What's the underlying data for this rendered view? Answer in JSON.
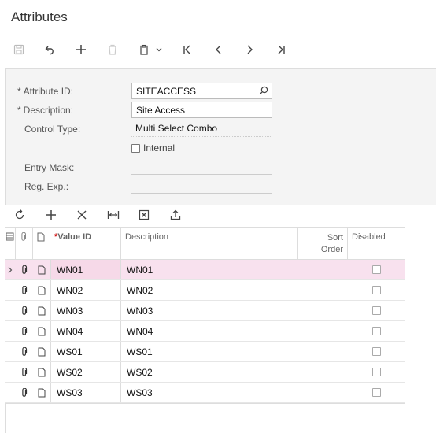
{
  "page": {
    "title": "Attributes"
  },
  "toolbar": {
    "buttons": [
      "save-icon",
      "undo-icon",
      "add-icon",
      "delete-icon",
      "clipboard-icon",
      "first-icon",
      "prev-icon",
      "next-icon",
      "last-icon"
    ]
  },
  "form": {
    "attribute_id_label": "Attribute ID:",
    "attribute_id_value": "SITEACCESS",
    "description_label": "Description:",
    "description_value": "Site Access",
    "control_type_label": "Control Type:",
    "control_type_value": "Multi Select Combo",
    "internal_label": "Internal",
    "internal_checked": false,
    "entry_mask_label": "Entry Mask:",
    "entry_mask_value": "",
    "reg_exp_label": "Reg. Exp.:",
    "reg_exp_value": "",
    "required_marker": "*"
  },
  "grid_toolbar": {
    "buttons": [
      "refresh-icon",
      "add-row-icon",
      "delete-row-icon",
      "fit-columns-icon",
      "export-excel-icon",
      "upload-icon"
    ]
  },
  "grid": {
    "columns": {
      "value_id": "Value ID",
      "description": "Description",
      "sort_order_1": "Sort",
      "sort_order_2": "Order",
      "disabled": "Disabled",
      "required_marker": "*"
    },
    "rows": [
      {
        "value_id": "WN01",
        "description": "WN01",
        "disabled": false
      },
      {
        "value_id": "WN02",
        "description": "WN02",
        "disabled": false
      },
      {
        "value_id": "WN03",
        "description": "WN03",
        "disabled": false
      },
      {
        "value_id": "WN04",
        "description": "WN04",
        "disabled": false
      },
      {
        "value_id": "WS01",
        "description": "WS01",
        "disabled": false
      },
      {
        "value_id": "WS02",
        "description": "WS02",
        "disabled": false
      },
      {
        "value_id": "WS03",
        "description": "WS03",
        "disabled": false
      }
    ],
    "selected_row": 0
  }
}
